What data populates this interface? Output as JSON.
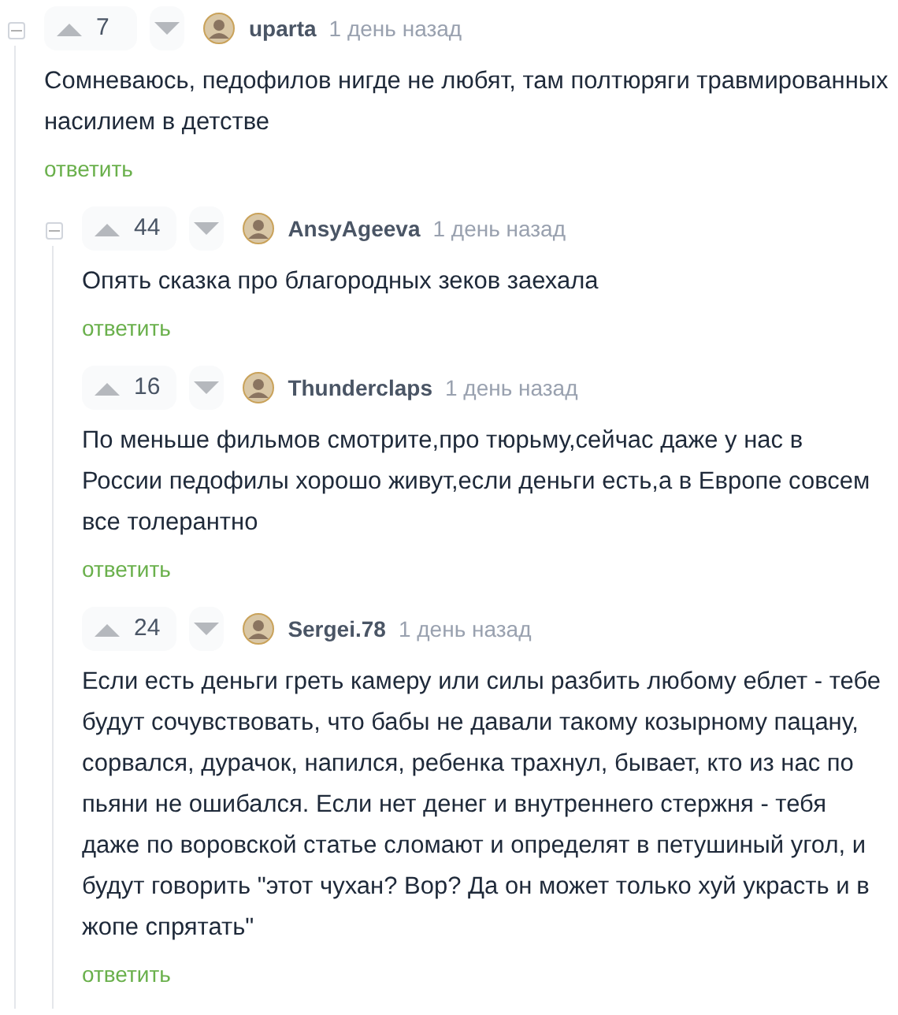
{
  "comments": [
    {
      "rating": "7",
      "author": "uparta",
      "time": "1 день назад",
      "text": "Сомневаюсь, педофилов нигде не любят, там полтюряги травмированных насилием в детстве",
      "reply": "ответить",
      "expanded": true,
      "children": [
        {
          "rating": "44",
          "author": "AnsyAgeeva",
          "time": "1 день назад",
          "text": "Опять сказка про благородных зеков заехала",
          "reply": "ответить",
          "expanded": true
        },
        {
          "rating": "16",
          "author": "Thunderclaps",
          "time": "1 день назад",
          "text": "По меньше фильмов смотрите,про тюрьму,сейчас даже у нас в России педофилы хорошо живут,если деньги есть,а в Европе совсем все толерантно",
          "reply": "ответить"
        },
        {
          "rating": "24",
          "author": "Sergei.78",
          "time": "1 день назад",
          "text": "Если есть деньги греть камеру или силы разбить любому еблет - тебе будут сочувствовать, что бабы не давали такому козырному пацану, сорвался, дурачок, напился, ребенка трахнул, бывает, кто из нас по пьяни не ошибался. Если нет денег и внутреннего стержня - тебя даже по воровской статье сломают и определят в петушиный угол, и будут говорить \"этот чухан? Вор? Да он может только хуй украсть и в жопе спрятать\"",
          "reply": "ответить"
        }
      ]
    }
  ]
}
